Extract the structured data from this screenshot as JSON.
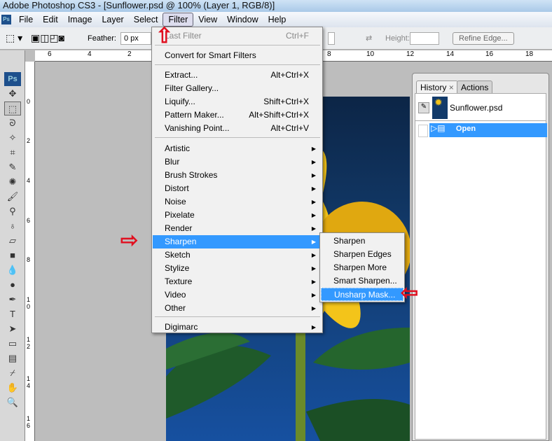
{
  "window": {
    "title": "Adobe Photoshop CS3 - [Sunflower.psd @ 100% (Layer 1, RGB/8)]"
  },
  "menubar": {
    "logo": "Ps",
    "items": [
      "File",
      "Edit",
      "Image",
      "Layer",
      "Select",
      "Filter",
      "View",
      "Window",
      "Help"
    ],
    "active": "Filter"
  },
  "options": {
    "feather_label": "Feather:",
    "feather_value": "0 px",
    "height_label": "Height:",
    "refine_edge": "Refine Edge..."
  },
  "ruler": {
    "h_ticks": [
      "6",
      "4",
      "2",
      "8",
      "10",
      "12",
      "14",
      "16",
      "18"
    ],
    "v_ticks": [
      "0",
      "2",
      "4",
      "6",
      "8",
      "1 0",
      "1 2",
      "1 4",
      "1 6"
    ]
  },
  "filter_menu": {
    "items": [
      {
        "label": "Last Filter",
        "shortcut": "Ctrl+F",
        "disabled": true
      },
      {
        "label": "Convert for Smart Filters"
      },
      {
        "label": "Extract...",
        "shortcut": "Alt+Ctrl+X"
      },
      {
        "label": "Filter Gallery..."
      },
      {
        "label": "Liquify...",
        "shortcut": "Shift+Ctrl+X"
      },
      {
        "label": "Pattern Maker...",
        "shortcut": "Alt+Shift+Ctrl+X"
      },
      {
        "label": "Vanishing Point...",
        "shortcut": "Alt+Ctrl+V"
      },
      {
        "label": "Artistic",
        "submenu": true
      },
      {
        "label": "Blur",
        "submenu": true
      },
      {
        "label": "Brush Strokes",
        "submenu": true
      },
      {
        "label": "Distort",
        "submenu": true
      },
      {
        "label": "Noise",
        "submenu": true
      },
      {
        "label": "Pixelate",
        "submenu": true
      },
      {
        "label": "Render",
        "submenu": true
      },
      {
        "label": "Sharpen",
        "submenu": true,
        "highlighted": true
      },
      {
        "label": "Sketch",
        "submenu": true
      },
      {
        "label": "Stylize",
        "submenu": true
      },
      {
        "label": "Texture",
        "submenu": true
      },
      {
        "label": "Video",
        "submenu": true
      },
      {
        "label": "Other",
        "submenu": true
      },
      {
        "label": "Digimarc",
        "submenu": true
      }
    ]
  },
  "sharpen_submenu": {
    "items": [
      "Sharpen",
      "Sharpen Edges",
      "Sharpen More",
      "Smart Sharpen...",
      "Unsharp Mask..."
    ],
    "highlighted": "Unsharp Mask..."
  },
  "history_panel": {
    "tabs": [
      "History",
      "Actions"
    ],
    "active_tab": "History",
    "snapshot": "Sunflower.psd",
    "states": [
      {
        "label": "Open",
        "selected": true
      }
    ]
  },
  "colors": {
    "highlight": "#3399ff",
    "annotation_arrow": "#e01020"
  }
}
